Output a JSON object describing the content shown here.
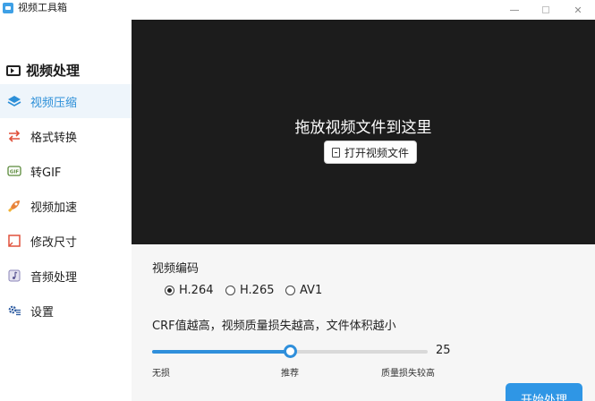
{
  "window": {
    "title": "视频工具箱",
    "close_glyph": "✕"
  },
  "sidebar": {
    "header": "视频处理",
    "items": [
      {
        "label": "视频压缩",
        "icon": "layers-icon",
        "active": true
      },
      {
        "label": "格式转换",
        "icon": "convert-arrows-icon",
        "active": false
      },
      {
        "label": "转GIF",
        "icon": "gif-icon",
        "active": false
      },
      {
        "label": "视频加速",
        "icon": "rocket-icon",
        "active": false
      },
      {
        "label": "修改尺寸",
        "icon": "resize-icon",
        "active": false
      },
      {
        "label": "音频处理",
        "icon": "music-note-icon",
        "active": false
      },
      {
        "label": "设置",
        "icon": "gear-icon",
        "active": false
      }
    ]
  },
  "preview": {
    "drop_text": "拖放视频文件到这里",
    "open_button": "打开视频文件"
  },
  "encoding": {
    "label": "视频编码",
    "options": [
      "H.264",
      "H.265",
      "AV1"
    ],
    "selected": "H.264"
  },
  "crf": {
    "label": "CRF值越高，视频质量损失越高，文件体积越小",
    "value": "25",
    "slider_fraction": 0.5,
    "tick_low": "无损",
    "tick_mid": "推荐",
    "tick_high": "质量损失较高"
  },
  "actions": {
    "start": "开始处理"
  },
  "colors": {
    "accent": "#2f8fdb",
    "preview_bg": "#1c1c1c",
    "active_bg": "#eef5fb"
  }
}
